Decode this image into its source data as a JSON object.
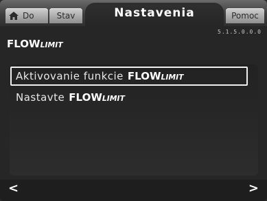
{
  "tabs": {
    "home_label": "Do",
    "stav_label": "Stav",
    "active_label": "Nastavenia",
    "pomoc_label": "Pomoc"
  },
  "version": "5.1.5.0.0.0",
  "page": {
    "title_flow": "FLOW",
    "title_limit": "LIMIT"
  },
  "menu": {
    "items": [
      {
        "text": "Aktivovanie funkcie",
        "flow": "FLOW",
        "limit": "LIMIT",
        "selected": true
      },
      {
        "text": "Nastavte",
        "flow": "FLOW",
        "limit": "LIMIT",
        "selected": false
      }
    ]
  },
  "nav": {
    "left": "<",
    "right": ">"
  },
  "colors": {
    "background": "#262626",
    "tab": "#b0b0b0",
    "text": "#ffffff"
  },
  "icons": {
    "home": "home-icon"
  }
}
